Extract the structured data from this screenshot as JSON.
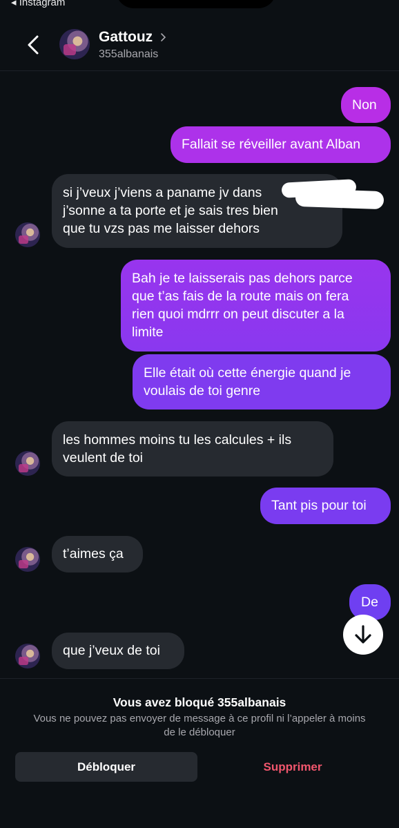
{
  "status_bar": {
    "back_app": "◂ Instagram"
  },
  "header": {
    "name": "Gattouz",
    "handle": "355albanais"
  },
  "messages": [
    {
      "side": "out",
      "lines": [
        "Non"
      ]
    },
    {
      "side": "out",
      "lines": [
        "Fallait se réveiller avant Alban"
      ]
    },
    {
      "side": "in",
      "lines": [
        "si j’veux j’viens a paname jv dans",
        "j’sonne a ta porte et je sais tres bien",
        "que tu vzs pas me laisser dehors"
      ]
    },
    {
      "side": "out",
      "lines": [
        "Bah je te laisserais pas dehors parce",
        "que t’as fais de la route mais on fera",
        "rien quoi mdrrr on peut discuter a la",
        "limite"
      ]
    },
    {
      "side": "out",
      "lines": [
        "Elle était où cette énergie quand je",
        "voulais de toi genre"
      ]
    },
    {
      "side": "in",
      "lines": [
        "les hommes moins tu les calcules + ils",
        "veulent de toi"
      ]
    },
    {
      "side": "out",
      "lines": [
        "Tant pis pour toi"
      ]
    },
    {
      "side": "in",
      "lines": [
        "t’aimes ça"
      ]
    },
    {
      "side": "out",
      "lines": [
        "De"
      ]
    },
    {
      "side": "in",
      "lines": [
        "que j’veux de toi"
      ]
    }
  ],
  "footer": {
    "title": "Vous avez bloqué 355albanais",
    "description": "Vous ne pouvez pas envoyer de message à ce profil ni l’appeler à moins de le débloquer",
    "unblock_label": "Débloquer",
    "delete_label": "Supprimer"
  },
  "colors": {
    "outgoing_top": "#b230e8",
    "outgoing_bottom": "#7a3cf0",
    "incoming": "#262a30",
    "delete": "#f0566d"
  }
}
